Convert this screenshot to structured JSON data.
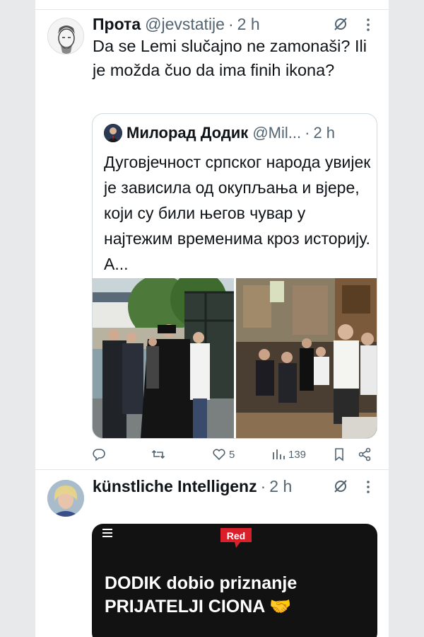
{
  "tweet1": {
    "name": "Прота",
    "handle": "@jevstatije",
    "separator": "·",
    "time": "2 h",
    "text": "Da se Lemi slučajno ne zamonaši? Ili je možda čuo da ima finih ikona?",
    "quote": {
      "name": "Милорад Додик",
      "handle": "@Mil...",
      "separator": "·",
      "time": "2 h",
      "text": "Дуговјечност српског народа увијек је зависила од окупљања и вјере, који су били његов чувар у најтежим временима кроз историју. А..."
    },
    "actions": {
      "reply_count": "",
      "retweet_count": "",
      "like_count": "5",
      "views_count": "139"
    }
  },
  "tweet2": {
    "name": "künstliche Intelligenz",
    "separator": "·",
    "time": "2 h",
    "media": {
      "logo_text": "Red",
      "headline_line1": "DODIK dobio priznanje",
      "headline_line2": "PRIJATELJI CIONA 🤝"
    }
  },
  "icons": [
    "grok-icon",
    "more-icon",
    "reply-icon",
    "retweet-icon",
    "like-icon",
    "views-icon",
    "bookmark-icon",
    "share-icon",
    "menu-icon"
  ],
  "colors": {
    "text": "#0f1419",
    "muted": "#536471",
    "border": "#cfd9de",
    "logo_red": "#d9202a"
  }
}
